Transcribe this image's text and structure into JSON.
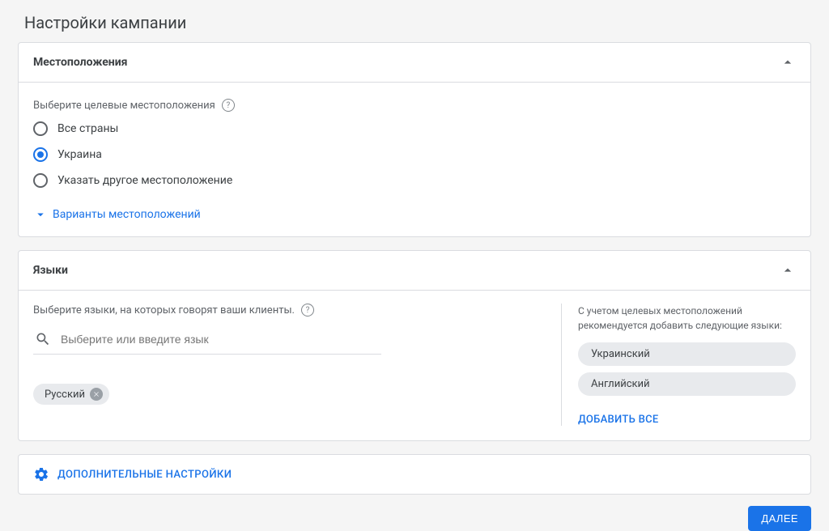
{
  "page_title": "Настройки кампании",
  "locations": {
    "header": "Местоположения",
    "prompt": "Выберите целевые местоположения",
    "options": [
      {
        "label": "Все страны",
        "selected": false
      },
      {
        "label": "Украина",
        "selected": true
      },
      {
        "label": "Указать другое местоположение",
        "selected": false
      }
    ],
    "expander": "Варианты местоположений"
  },
  "languages": {
    "header": "Языки",
    "prompt": "Выберите языки, на которых говорят ваши клиенты.",
    "search_placeholder": "Выберите или введите язык",
    "selected_chip": "Русский",
    "reco_text": "С учетом целевых местоположений рекомендуется добавить следующие языки:",
    "reco_items": [
      "Украинский",
      "Английский"
    ],
    "add_all": "ДОБАВИТЬ ВСЕ"
  },
  "additional_settings": "ДОПОЛНИТЕЛЬНЫЕ НАСТРОЙКИ",
  "next_button": "ДАЛЕЕ"
}
